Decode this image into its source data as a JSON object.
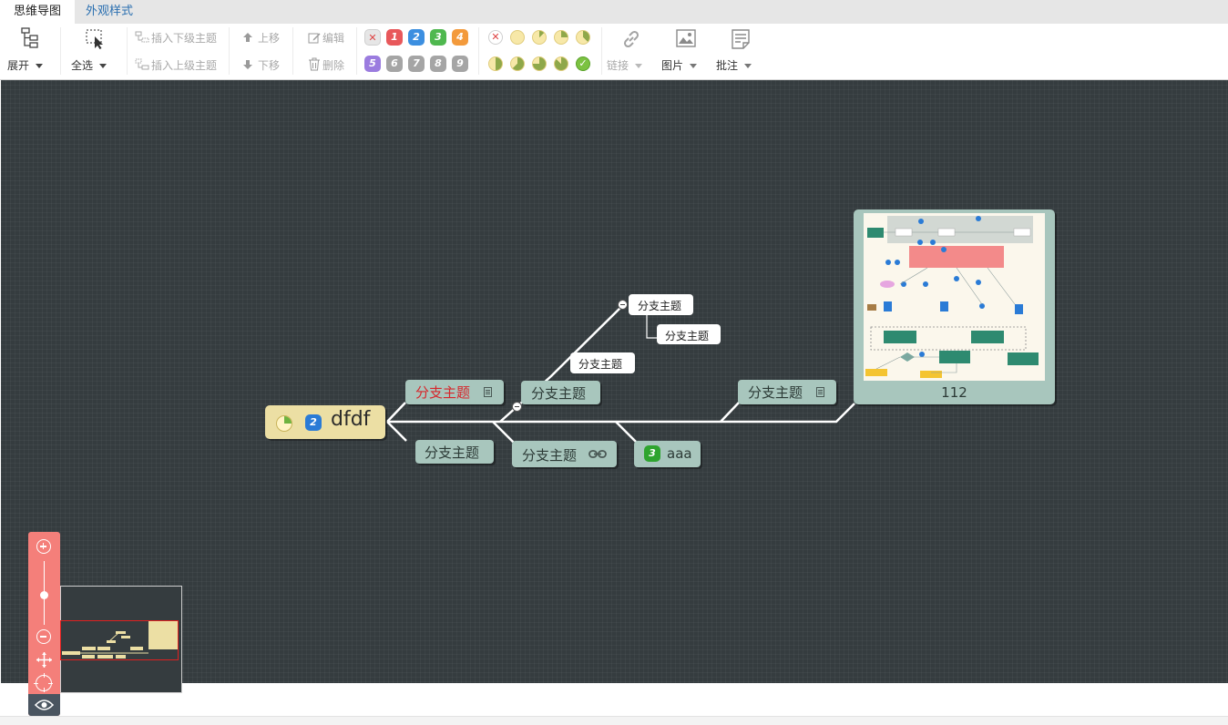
{
  "tabs": [
    {
      "label": "思维导图",
      "active": true
    },
    {
      "label": "外观样式",
      "active": false
    }
  ],
  "toolbar": {
    "expand_label": "展开",
    "select_all_label": "全选",
    "insert_child_label": "插入下级主题",
    "insert_parent_label": "插入上级主题",
    "move_up_label": "上移",
    "move_down_label": "下移",
    "edit_label": "编辑",
    "delete_label": "删除",
    "link_label": "链接",
    "image_label": "图片",
    "note_label": "批注",
    "priorities": [
      {
        "label": "",
        "color": "#e6e6e6",
        "icon": "remove-priority-icon"
      },
      {
        "label": "1",
        "color": "#e8585b"
      },
      {
        "label": "2",
        "color": "#3c8fe0"
      },
      {
        "label": "3",
        "color": "#4fb84f"
      },
      {
        "label": "4",
        "color": "#f39a3c"
      },
      {
        "label": "5",
        "color": "#9b7cdf"
      },
      {
        "label": "6",
        "color": "#a5a5a5"
      },
      {
        "label": "7",
        "color": "#a5a5a5"
      },
      {
        "label": "8",
        "color": "#a5a5a5"
      },
      {
        "label": "9",
        "color": "#a5a5a5"
      }
    ],
    "progress": [
      {
        "name": "remove-progress-icon",
        "fraction": -1
      },
      {
        "name": "progress-0-icon",
        "fraction": 0
      },
      {
        "name": "progress-1-icon",
        "fraction": 0.125
      },
      {
        "name": "progress-2-icon",
        "fraction": 0.25
      },
      {
        "name": "progress-3-icon",
        "fraction": 0.375
      },
      {
        "name": "progress-4-icon",
        "fraction": 0.5
      },
      {
        "name": "progress-5-icon",
        "fraction": 0.625
      },
      {
        "name": "progress-6-icon",
        "fraction": 0.75
      },
      {
        "name": "progress-7-icon",
        "fraction": 0.875
      },
      {
        "name": "progress-done-icon",
        "fraction": 1
      }
    ]
  },
  "mindmap": {
    "root": {
      "label": "dfdf",
      "priority": "2",
      "progress_fraction": 0.25
    },
    "topics": {
      "upper_red": "分支主题",
      "upper_middle": "分支主题",
      "upper_right": "分支主题",
      "lower_left": "分支主题",
      "lower_middle": "分支主题",
      "lower_right": "aaa",
      "lower_right_priority": "3",
      "sub_a": "分支主题",
      "sub_b": "分支主题",
      "sub_c": "分支主题"
    },
    "image_node_label": "112"
  },
  "colors": {
    "canvas": "#353c3f",
    "topic": "#a8c6bd",
    "root": "#ecdfa4",
    "zoombar": "#f47f7a",
    "red_text": "#d6262b"
  }
}
